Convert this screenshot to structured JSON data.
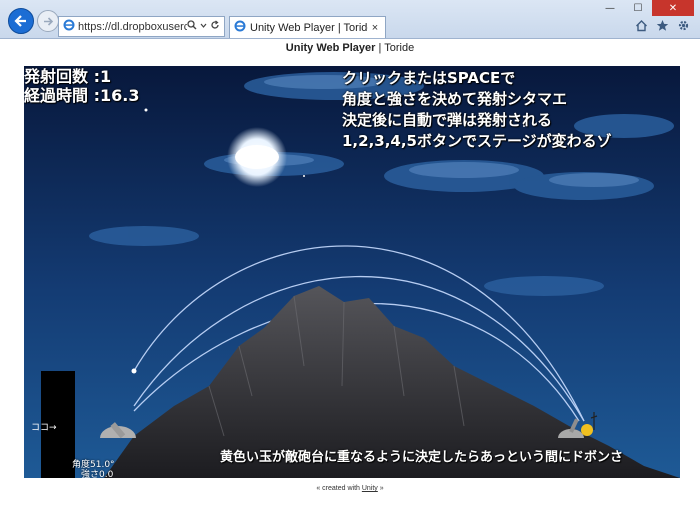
{
  "browser": {
    "url": "https://dl.dropboxusercont...",
    "tab_title": "Unity Web Player | Toride",
    "tab_close": "×",
    "minimize": "—",
    "maximize": "☐",
    "close": "✕",
    "icons": [
      "back-arrow-icon",
      "forward-arrow-icon",
      "ie-logo-icon",
      "search-icon",
      "dropdown-icon",
      "refresh-icon",
      "home-icon",
      "star-icon",
      "gear-icon"
    ]
  },
  "page": {
    "header_bold": "Unity Web Player",
    "header_sep": " | ",
    "header_rest": "Toride",
    "credit_prefix": "« created with ",
    "credit_link": "Unity",
    "credit_suffix": " »"
  },
  "game": {
    "shots_label": "発射回数 :1",
    "time_label": "経過時間 :16.3",
    "instructions": [
      "クリックまたはSPACEで",
      "角度と強さを決めて発射シタマエ",
      "決定後に自動で弾は発射される",
      "1,2,3,4,5ボタンでステージが変わるゾ"
    ],
    "koko_label": "ココ→",
    "angle_label": "角度51.0°",
    "strength_label": "強さ0.0",
    "bottom_message": "黄色い玉が敵砲台に重なるように決定したらあっという間にドボンさ",
    "colors": {
      "sky_top": "#08183c",
      "sky_bottom": "#1e5a96",
      "mountain": "#2f2f33",
      "trajectory": "#c8dcff",
      "enemy_ball": "#f0c020"
    }
  }
}
